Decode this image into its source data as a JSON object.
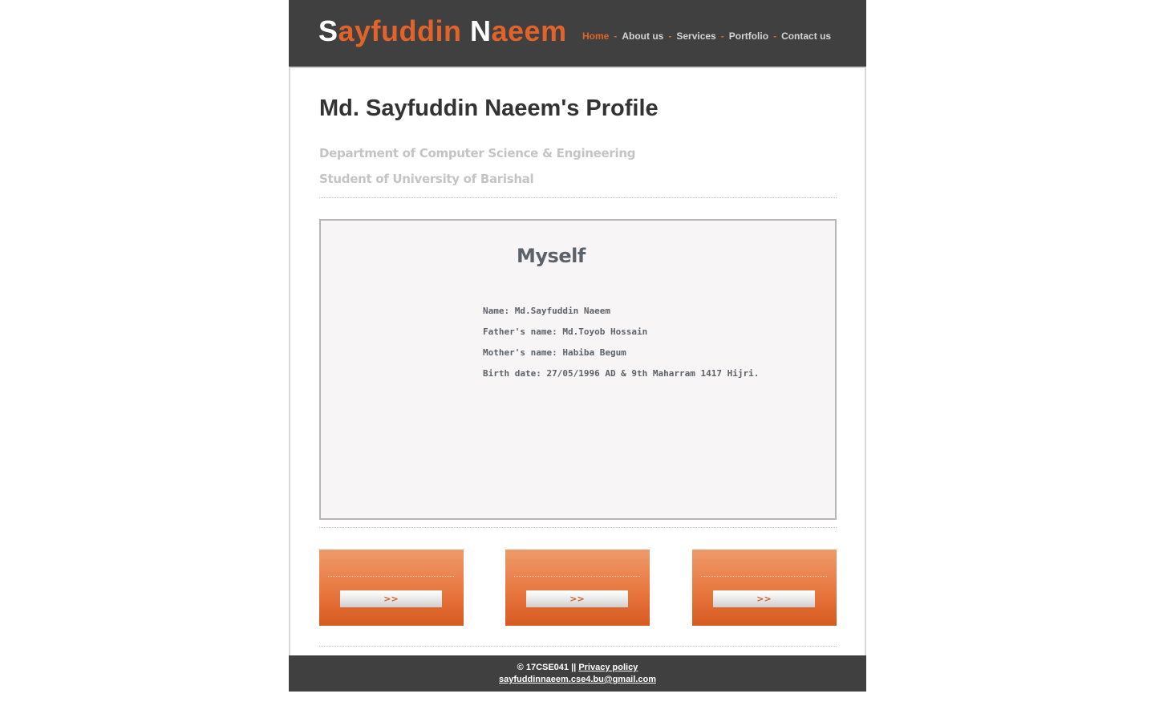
{
  "header": {
    "logo": {
      "first_cap": "S",
      "first_rest": "ayfuddin ",
      "last_cap": "N",
      "last_rest": "aeem"
    },
    "nav": [
      {
        "label": "Home",
        "active": true
      },
      {
        "label": "About us",
        "active": false
      },
      {
        "label": "Services",
        "active": false
      },
      {
        "label": "Portfolio",
        "active": false
      },
      {
        "label": "Contact us",
        "active": false
      }
    ],
    "nav_separator": "-"
  },
  "main": {
    "title": "Md. Sayfuddin Naeem's Profile",
    "subtitle_department": "Department of Computer Science & Engineering",
    "subtitle_university": "Student of University of Barishal",
    "profile": {
      "heading": "Myself",
      "details": [
        "Name: Md.Sayfuddin Naeem",
        "Father's name: Md.Toyob Hossain",
        "Mother's name: Habiba Begum",
        "Birth date: 27/05/1996 AD & 9th Maharram 1417 Hijri."
      ]
    },
    "cards": [
      {
        "button_label": ">>"
      },
      {
        "button_label": ">>"
      },
      {
        "button_label": ">>"
      }
    ]
  },
  "footer": {
    "copyright": "© 17CSE041 || ",
    "privacy_link": "Privacy policy",
    "email": "sayfuddinnaeem.cse4.bu@gmail.com"
  },
  "colors": {
    "accent": "#e2632a",
    "header_bg": "#404040",
    "profile_bg": "#f7f5f5"
  }
}
